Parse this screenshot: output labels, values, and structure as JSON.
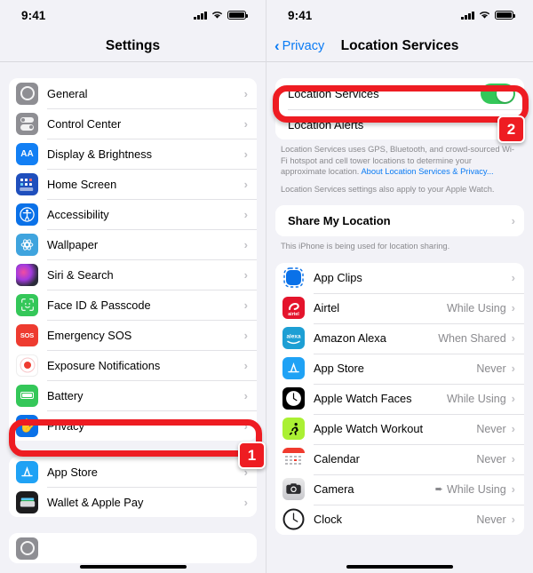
{
  "status_bar": {
    "time": "9:41",
    "signal_icon": "cellular-bars-icon",
    "wifi_icon": "wifi-icon",
    "battery_icon": "battery-full-icon"
  },
  "colors": {
    "accent_blue": "#0a7bf4",
    "annotation_red": "#ee1c22",
    "toggle_green": "#34c759",
    "page_bg": "#f2f2f7"
  },
  "left_screen": {
    "nav_title": "Settings",
    "group1": [
      {
        "label": "General",
        "icon": "gear-icon"
      },
      {
        "label": "Control Center",
        "icon": "control-center-icon"
      },
      {
        "label": "Display & Brightness",
        "icon": "display-brightness-icon"
      },
      {
        "label": "Home Screen",
        "icon": "home-screen-icon"
      },
      {
        "label": "Accessibility",
        "icon": "accessibility-icon"
      },
      {
        "label": "Wallpaper",
        "icon": "wallpaper-icon"
      },
      {
        "label": "Siri & Search",
        "icon": "siri-icon"
      },
      {
        "label": "Face ID & Passcode",
        "icon": "face-id-icon"
      },
      {
        "label": "Emergency SOS",
        "icon": "emergency-sos-icon"
      },
      {
        "label": "Exposure Notifications",
        "icon": "exposure-notifications-icon"
      },
      {
        "label": "Battery",
        "icon": "battery-icon"
      },
      {
        "label": "Privacy",
        "icon": "privacy-hand-icon"
      }
    ],
    "group2": [
      {
        "label": "App Store",
        "icon": "app-store-icon"
      },
      {
        "label": "Wallet & Apple Pay",
        "icon": "wallet-icon"
      }
    ]
  },
  "right_screen": {
    "back_label": "Privacy",
    "nav_title": "Location Services",
    "toggle_row": {
      "label": "Location Services",
      "state": "on"
    },
    "alerts_row": {
      "label": "Location Alerts"
    },
    "footnote_1": "Location Services uses GPS, Bluetooth, and crowd-sourced Wi-Fi hotspot and cell tower locations to determine your approximate location. ",
    "footnote_1_link": "About Location Services & Privacy...",
    "footnote_2": "Location Services settings also apply to your Apple Watch.",
    "share_row": {
      "label": "Share My Location"
    },
    "footnote_3": "This iPhone is being used for location sharing.",
    "apps": [
      {
        "label": "App Clips",
        "value": "",
        "icon": "app-clips-icon",
        "arrow": false
      },
      {
        "label": "Airtel",
        "value": "While Using",
        "icon": "airtel-icon",
        "arrow": false
      },
      {
        "label": "Amazon Alexa",
        "value": "When Shared",
        "icon": "amazon-alexa-icon",
        "arrow": false
      },
      {
        "label": "App Store",
        "value": "Never",
        "icon": "app-store-icon",
        "arrow": false
      },
      {
        "label": "Apple Watch Faces",
        "value": "While Using",
        "icon": "apple-watch-faces-icon",
        "arrow": false
      },
      {
        "label": "Apple Watch Workout",
        "value": "Never",
        "icon": "apple-watch-workout-icon",
        "arrow": false
      },
      {
        "label": "Calendar",
        "value": "Never",
        "icon": "calendar-icon",
        "arrow": false
      },
      {
        "label": "Camera",
        "value": "While Using",
        "icon": "camera-icon",
        "arrow": true
      },
      {
        "label": "Clock",
        "value": "Never",
        "icon": "clock-icon",
        "arrow": false
      }
    ]
  },
  "annotations": {
    "step1": "1",
    "step2": "2"
  }
}
